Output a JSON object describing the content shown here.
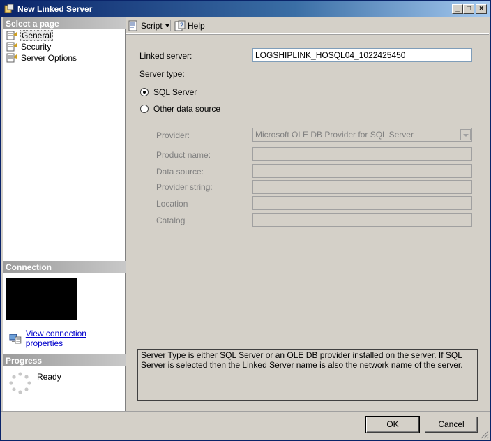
{
  "window": {
    "title": "New Linked Server"
  },
  "left": {
    "select_page_header": "Select a page",
    "pages": [
      {
        "label": "General"
      },
      {
        "label": "Security"
      },
      {
        "label": "Server Options"
      }
    ],
    "connection_header": "Connection",
    "view_connection_properties": "View connection properties",
    "progress_header": "Progress",
    "progress_status": "Ready"
  },
  "toolbar": {
    "script_label": "Script",
    "help_label": "Help"
  },
  "form": {
    "linked_server_label": "Linked server:",
    "linked_server_value": "LOGSHIPLINK_HOSQL04_1022425450",
    "server_type_label": "Server type:",
    "sql_server_label": "SQL Server",
    "other_data_source_label": "Other data source",
    "provider_label": "Provider:",
    "provider_value": "Microsoft OLE DB Provider for SQL Server",
    "product_name_label": "Product name:",
    "data_source_label": "Data source:",
    "provider_string_label": "Provider string:",
    "location_label": "Location",
    "catalog_label": "Catalog",
    "description": "Server Type is either SQL Server or an OLE DB provider installed on the server. If SQL Server is selected then the Linked Server name is also the network name of the server."
  },
  "buttons": {
    "ok": "OK",
    "cancel": "Cancel"
  },
  "colors": {
    "title_bar": "#0a246a",
    "link": "#0000cc",
    "dialog_bg": "#d4d0c8"
  }
}
